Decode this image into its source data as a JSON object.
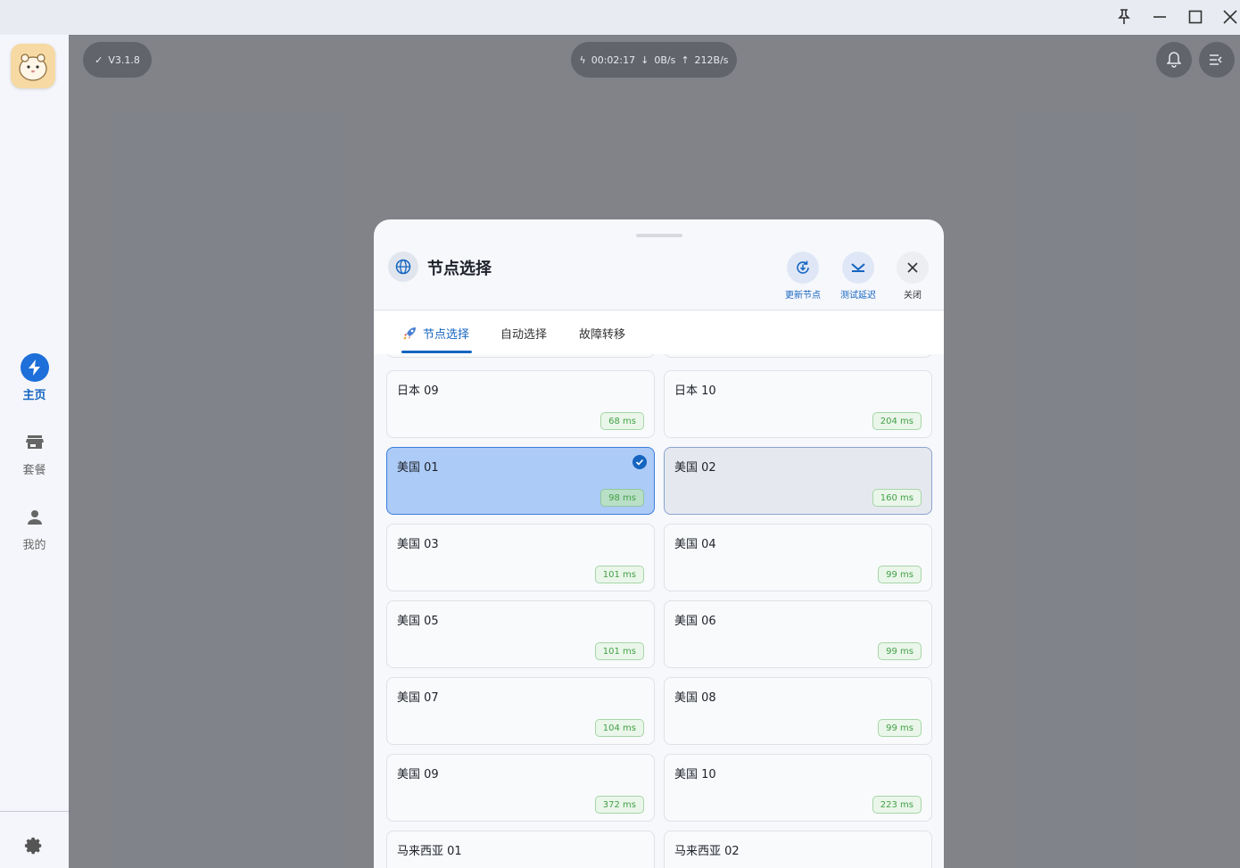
{
  "app": {
    "version_label": "V3.1.8",
    "status": {
      "timer": "00:02:17",
      "download": "0B/s",
      "upload": "212B/s"
    }
  },
  "sidebar": {
    "items": [
      {
        "label": "主页",
        "icon": "bolt-icon",
        "active": true
      },
      {
        "label": "套餐",
        "icon": "store-icon",
        "active": false
      },
      {
        "label": "我的",
        "icon": "person-icon",
        "active": false
      }
    ]
  },
  "modal": {
    "title": "节点选择",
    "buttons": {
      "update": "更新节点",
      "test": "测试延迟",
      "close": "关闭"
    },
    "tabs": [
      {
        "label": "节点选择",
        "active": true
      },
      {
        "label": "自动选择",
        "active": false
      },
      {
        "label": "故障转移",
        "active": false
      }
    ],
    "nodes": [
      {
        "name": "日本 09",
        "latency": "68 ms"
      },
      {
        "name": "日本 10",
        "latency": "204 ms"
      },
      {
        "name": "美国 01",
        "latency": "98 ms",
        "selected": true
      },
      {
        "name": "美国 02",
        "latency": "160 ms"
      },
      {
        "name": "美国 03",
        "latency": "101 ms"
      },
      {
        "name": "美国 04",
        "latency": "99 ms"
      },
      {
        "name": "美国 05",
        "latency": "101 ms"
      },
      {
        "name": "美国 06",
        "latency": "99 ms"
      },
      {
        "name": "美国 07",
        "latency": "104 ms"
      },
      {
        "name": "美国 08",
        "latency": "99 ms"
      },
      {
        "name": "美国 09",
        "latency": "372 ms"
      },
      {
        "name": "美国 10",
        "latency": "223 ms"
      },
      {
        "name": "马来西亚 01",
        "latency": ""
      },
      {
        "name": "马来西亚 02",
        "latency": ""
      }
    ]
  },
  "colors": {
    "accent": "#1565c0",
    "latency_green": "#43a047",
    "selected_bg": "#adcbf7"
  }
}
